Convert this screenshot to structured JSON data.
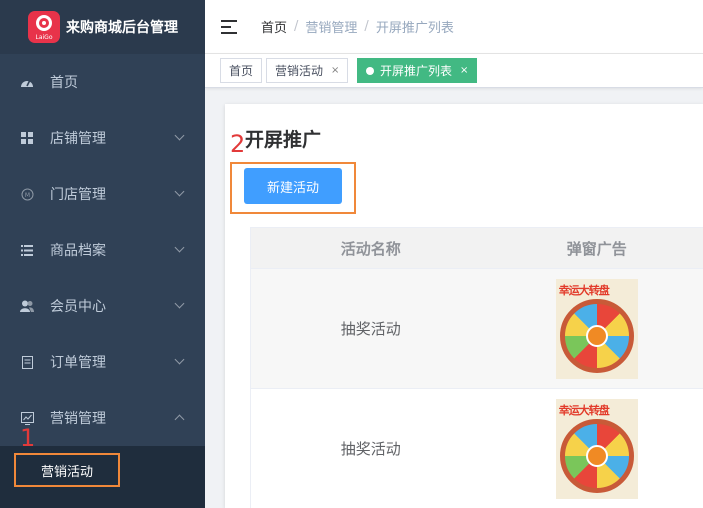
{
  "brand": {
    "logo_text": "LaiGo",
    "title": "来购商城后台管理"
  },
  "sidebar": {
    "items": [
      {
        "label": "首页",
        "icon": "dashboard-icon"
      },
      {
        "label": "店铺管理",
        "icon": "grid-icon"
      },
      {
        "label": "门店管理",
        "icon": "store-icon"
      },
      {
        "label": "商品档案",
        "icon": "list-icon"
      },
      {
        "label": "会员中心",
        "icon": "users-icon"
      },
      {
        "label": "订单管理",
        "icon": "order-icon"
      },
      {
        "label": "营销管理",
        "icon": "chart-icon"
      }
    ],
    "sub_items": [
      {
        "label": "营销活动"
      }
    ]
  },
  "annotations": {
    "step1": "1",
    "step2": "2",
    "color": "#e23a3a",
    "frame_color": "#f0883a"
  },
  "header": {
    "breadcrumb": [
      "首页",
      "营销管理",
      "开屏推广列表"
    ],
    "separator": "/"
  },
  "tags": [
    {
      "label": "首页",
      "closable": false,
      "active": false
    },
    {
      "label": "营销活动",
      "closable": true,
      "active": false
    },
    {
      "label": "开屏推广列表",
      "closable": true,
      "active": true
    }
  ],
  "tag_close": "×",
  "main": {
    "title": "开屏推广",
    "new_button": "新建活动",
    "table": {
      "columns": [
        "活动名称",
        "弹窗广告"
      ],
      "rows": [
        {
          "name": "抽奖活动",
          "image": "lottery-wheel-image",
          "banner": "幸运大转盘"
        },
        {
          "name": "抽奖活动",
          "image": "lottery-wheel-image",
          "banner": "幸运大转盘"
        }
      ]
    }
  },
  "colors": {
    "sidebar_bg": "#304156",
    "primary": "#409eff",
    "active_tag": "#42b983"
  }
}
